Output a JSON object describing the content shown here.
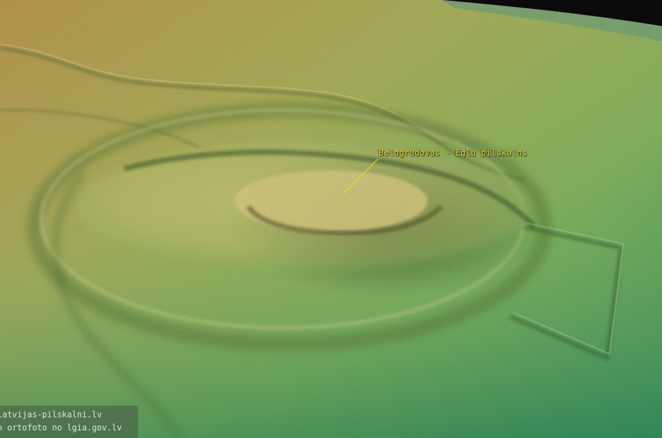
{
  "map": {
    "feature_label": "Belogrudovas - Eglu pilskalns",
    "credits": [
      "latvijas-pilskalni.lv",
      "n ortofoto no lgia.gov.lv"
    ]
  },
  "colors": {
    "label_text": "#f2e23a",
    "leader_line": "#e8dc3a",
    "credit_text": "#dfe6dc",
    "terrain_high": "#c9a85a",
    "terrain_mid": "#b9c46a",
    "terrain_low": "#4fa86a",
    "sky": "#0c0c0c"
  }
}
